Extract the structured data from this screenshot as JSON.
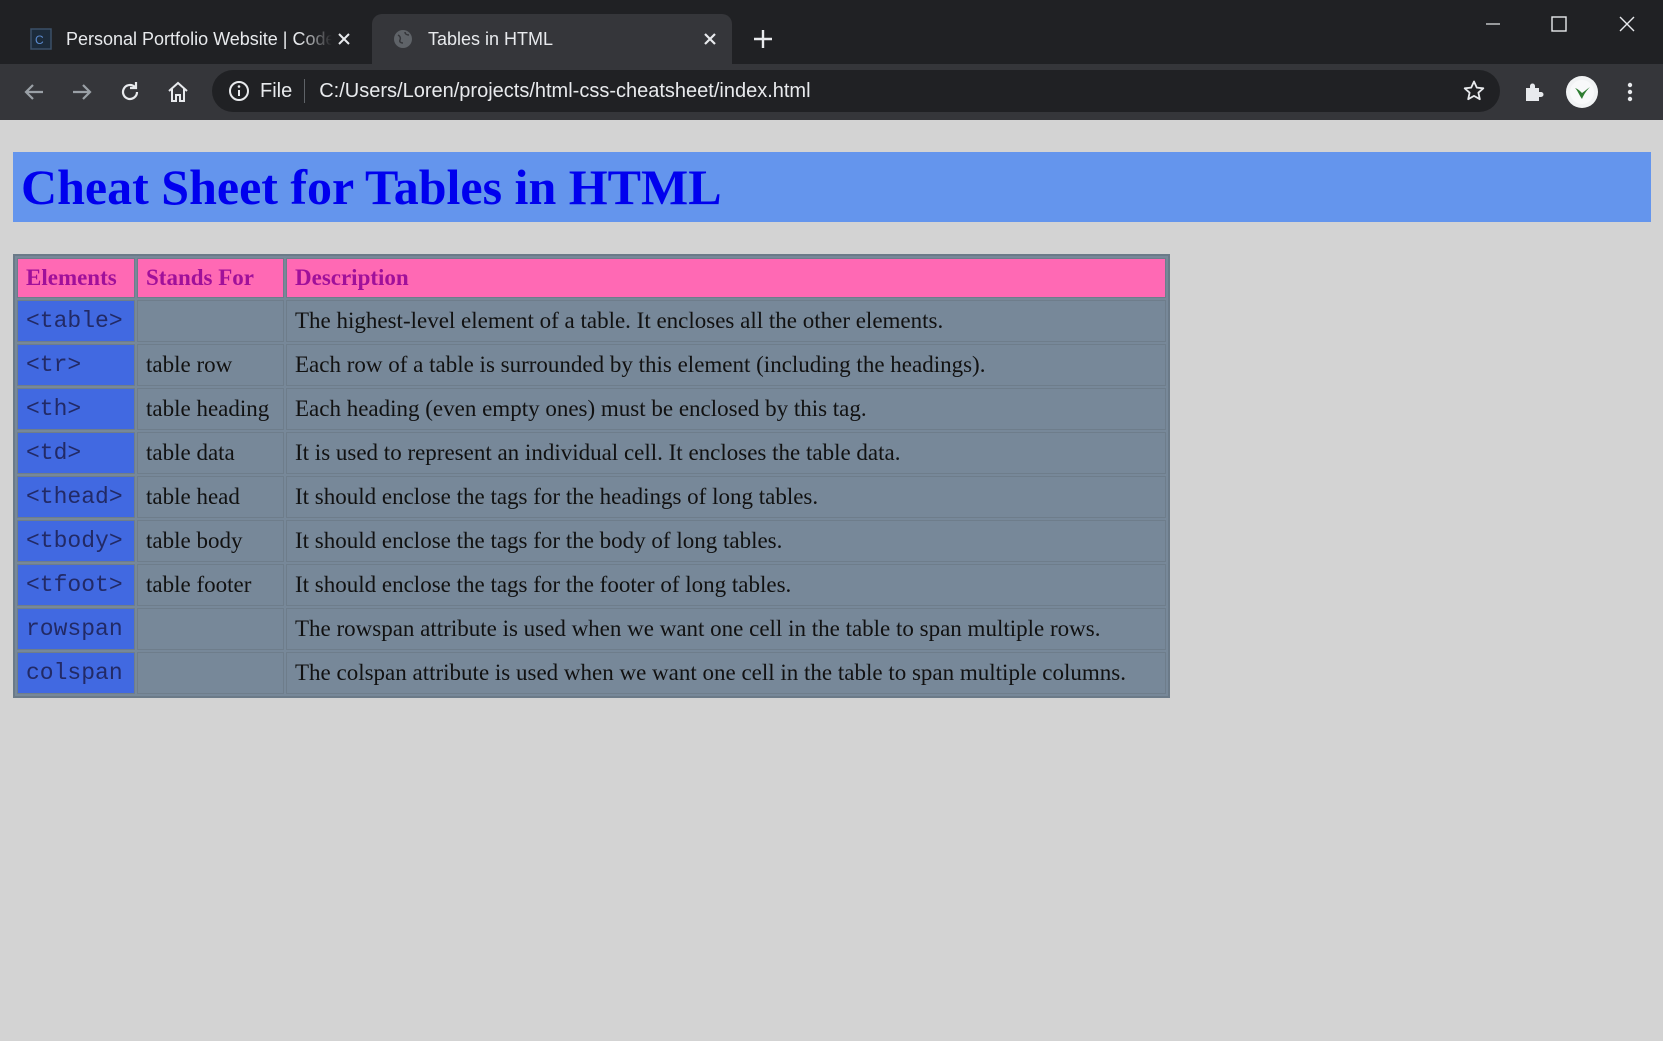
{
  "browser": {
    "tabs": [
      {
        "title": "Personal Portfolio Website | Codecademy",
        "active": false
      },
      {
        "title": "Tables in HTML",
        "active": true
      }
    ],
    "address": {
      "security_label": "File",
      "url": "C:/Users/Loren/projects/html-css-cheatsheet/index.html"
    }
  },
  "page": {
    "heading": "Cheat Sheet for Tables in HTML",
    "table": {
      "headers": [
        "Elements",
        "Stands For",
        "Description"
      ],
      "rows": [
        {
          "element": "<table>",
          "stands_for": "",
          "description": "The highest-level element of a table. It encloses all the other elements."
        },
        {
          "element": "<tr>",
          "stands_for": "table row",
          "description": "Each row of a table is surrounded by this element (including the headings)."
        },
        {
          "element": "<th>",
          "stands_for": "table heading",
          "description": "Each heading (even empty ones) must be enclosed by this tag."
        },
        {
          "element": "<td>",
          "stands_for": "table data",
          "description": "It is used to represent an individual cell. It encloses the table data."
        },
        {
          "element": "<thead>",
          "stands_for": "table head",
          "description": "It should enclose the tags for the headings of long tables."
        },
        {
          "element": "<tbody>",
          "stands_for": "table body",
          "description": "It should enclose the tags for the body of long tables."
        },
        {
          "element": "<tfoot>",
          "stands_for": "table footer",
          "description": "It should enclose the tags for the footer of long tables."
        },
        {
          "element": "rowspan",
          "stands_for": "",
          "description": "The rowspan attribute is used when we want one cell in the table to span multiple rows."
        },
        {
          "element": "colspan",
          "stands_for": "",
          "description": "The colspan attribute is used when we want one cell in the table to span multiple columns."
        }
      ]
    }
  },
  "colors": {
    "page_bg": "#d3d3d3",
    "heading_bg": "#6495ed",
    "heading_text": "#0000ee",
    "header_cell_bg": "#ff69b4",
    "header_text": "#a0109a",
    "element_cell_bg": "#4169e1",
    "body_cell_bg": "#778899"
  },
  "icons": [
    "codecademy-favicon",
    "globe-icon",
    "close-icon",
    "plus-icon",
    "minimize-icon",
    "maximize-icon",
    "window-close-icon",
    "back-arrow-icon",
    "forward-arrow-icon",
    "reload-icon",
    "home-icon",
    "info-icon",
    "star-icon",
    "extensions-icon",
    "menu-dots-icon"
  ]
}
